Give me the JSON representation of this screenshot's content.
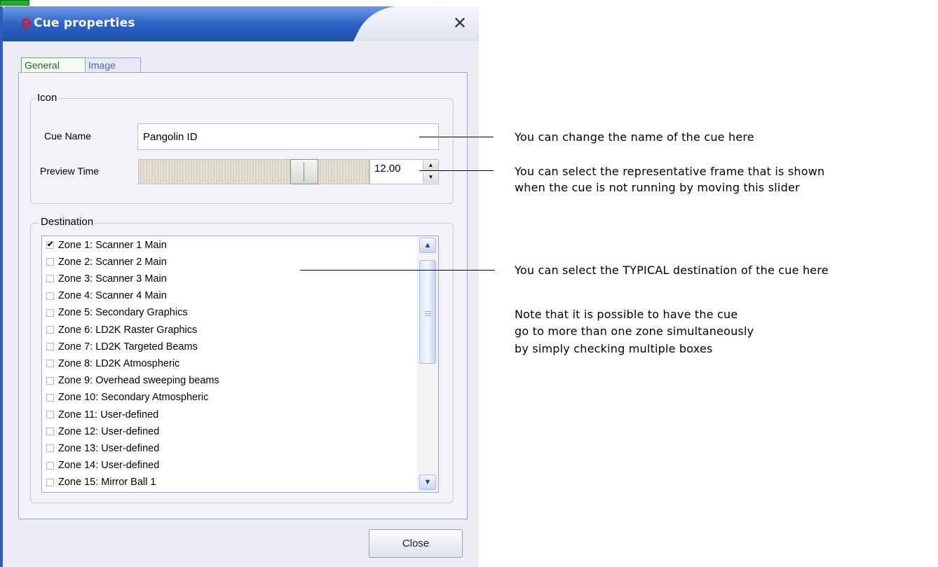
{
  "window": {
    "title": "Cue properties",
    "logo": "Q",
    "close_glyph": "✕",
    "accent_color": "#2f5fb8",
    "logo_color": "#e01818"
  },
  "tabs": [
    {
      "label": "General",
      "active": true
    },
    {
      "label": "Image",
      "active": false
    }
  ],
  "icon_group": {
    "legend": "Icon",
    "cue_name_label": "Cue Name",
    "cue_name_value": "Pangolin ID",
    "preview_time_label": "Preview Time",
    "preview_time_value": "12.00",
    "slider_level": 0.75
  },
  "destination_group": {
    "legend": "Destination",
    "zones": [
      {
        "label": "Zone 1: Scanner 1 Main",
        "checked": true
      },
      {
        "label": "Zone 2: Scanner 2 Main",
        "checked": false
      },
      {
        "label": "Zone 3: Scanner 3 Main",
        "checked": false
      },
      {
        "label": "Zone 4: Scanner 4 Main",
        "checked": false
      },
      {
        "label": "Zone 5: Secondary Graphics",
        "checked": false
      },
      {
        "label": "Zone 6: LD2K Raster Graphics",
        "checked": false
      },
      {
        "label": "Zone 7: LD2K Targeted Beams",
        "checked": false
      },
      {
        "label": "Zone 8: LD2K Atmospheric",
        "checked": false
      },
      {
        "label": "Zone 9: Overhead sweeping beams",
        "checked": false
      },
      {
        "label": "Zone 10: Secondary Atmospheric",
        "checked": false
      },
      {
        "label": "Zone 11: User-defined",
        "checked": false
      },
      {
        "label": "Zone 12: User-defined",
        "checked": false
      },
      {
        "label": "Zone 13: User-defined",
        "checked": false
      },
      {
        "label": "Zone 14: User-defined",
        "checked": false
      },
      {
        "label": "Zone 15: Mirror Ball 1",
        "checked": false
      }
    ]
  },
  "buttons": {
    "close_label": "Close"
  },
  "annotations": {
    "name_note": "You can change the name of the cue here",
    "slider_note_1": "You can select the representative frame that is shown",
    "slider_note_2": "when the cue is not running by moving this slider",
    "destination_note": "You can select the TYPICAL destination of the cue here",
    "multi_note_1": "Note that it is possible to have the cue",
    "multi_note_2": "go to more than one zone simultaneously",
    "multi_note_3": "by simply checking multiple boxes"
  }
}
